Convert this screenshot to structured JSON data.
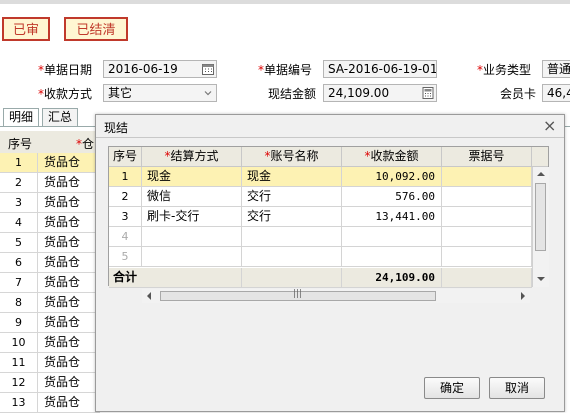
{
  "toolbar": {
    "audit_label": "已审",
    "settle_label": "已结清"
  },
  "form": {
    "date_label": "单据日期",
    "date_value": "2016-06-19",
    "docno_label": "单据编号",
    "docno_value": "SA-2016-06-19-01",
    "biztype_label": "业务类型",
    "biztype_value": "普通",
    "payway_label": "收款方式",
    "payway_value": "其它",
    "cash_label": "现结金额",
    "cash_value": "24,109.00",
    "member_label": "会员卡",
    "member_value": "46,4"
  },
  "tabs": [
    "明细",
    "汇总"
  ],
  "bg_grid": {
    "col_seq": "序号",
    "col_wh": "仓",
    "rows": [
      {
        "n": "1",
        "t": "货品仓"
      },
      {
        "n": "2",
        "t": "货品仓"
      },
      {
        "n": "3",
        "t": "货品仓"
      },
      {
        "n": "4",
        "t": "货品仓"
      },
      {
        "n": "5",
        "t": "货品仓"
      },
      {
        "n": "6",
        "t": "货品仓"
      },
      {
        "n": "7",
        "t": "货品仓"
      },
      {
        "n": "8",
        "t": "货品仓"
      },
      {
        "n": "9",
        "t": "货品仓"
      },
      {
        "n": "10",
        "t": "货品仓"
      },
      {
        "n": "11",
        "t": "货品仓"
      },
      {
        "n": "12",
        "t": "货品仓"
      },
      {
        "n": "13",
        "t": "货品仓"
      }
    ]
  },
  "dialog": {
    "title": "现结",
    "columns": {
      "seq": "序号",
      "method": "结算方式",
      "account": "账号名称",
      "amount": "收款金额",
      "ticket": "票据号"
    },
    "rows": [
      {
        "seq": "1",
        "method": "现金",
        "account": "现金",
        "amount": "10,092.00",
        "ticket": ""
      },
      {
        "seq": "2",
        "method": "微信",
        "account": "交行",
        "amount": "576.00",
        "ticket": ""
      },
      {
        "seq": "3",
        "method": "刷卡-交行",
        "account": "交行",
        "amount": "13,441.00",
        "ticket": ""
      },
      {
        "seq": "4",
        "method": "",
        "account": "",
        "amount": "",
        "ticket": ""
      },
      {
        "seq": "5",
        "method": "",
        "account": "",
        "amount": "",
        "ticket": ""
      }
    ],
    "total_label": "合计",
    "total_amount": "24,109.00",
    "ok_label": "确定",
    "cancel_label": "取消",
    "close_glyph": "×"
  },
  "colors": {
    "selected_row": "#fdf2b3",
    "stamp_red": "#c0392b",
    "stamp_bg": "#fff6d2"
  }
}
